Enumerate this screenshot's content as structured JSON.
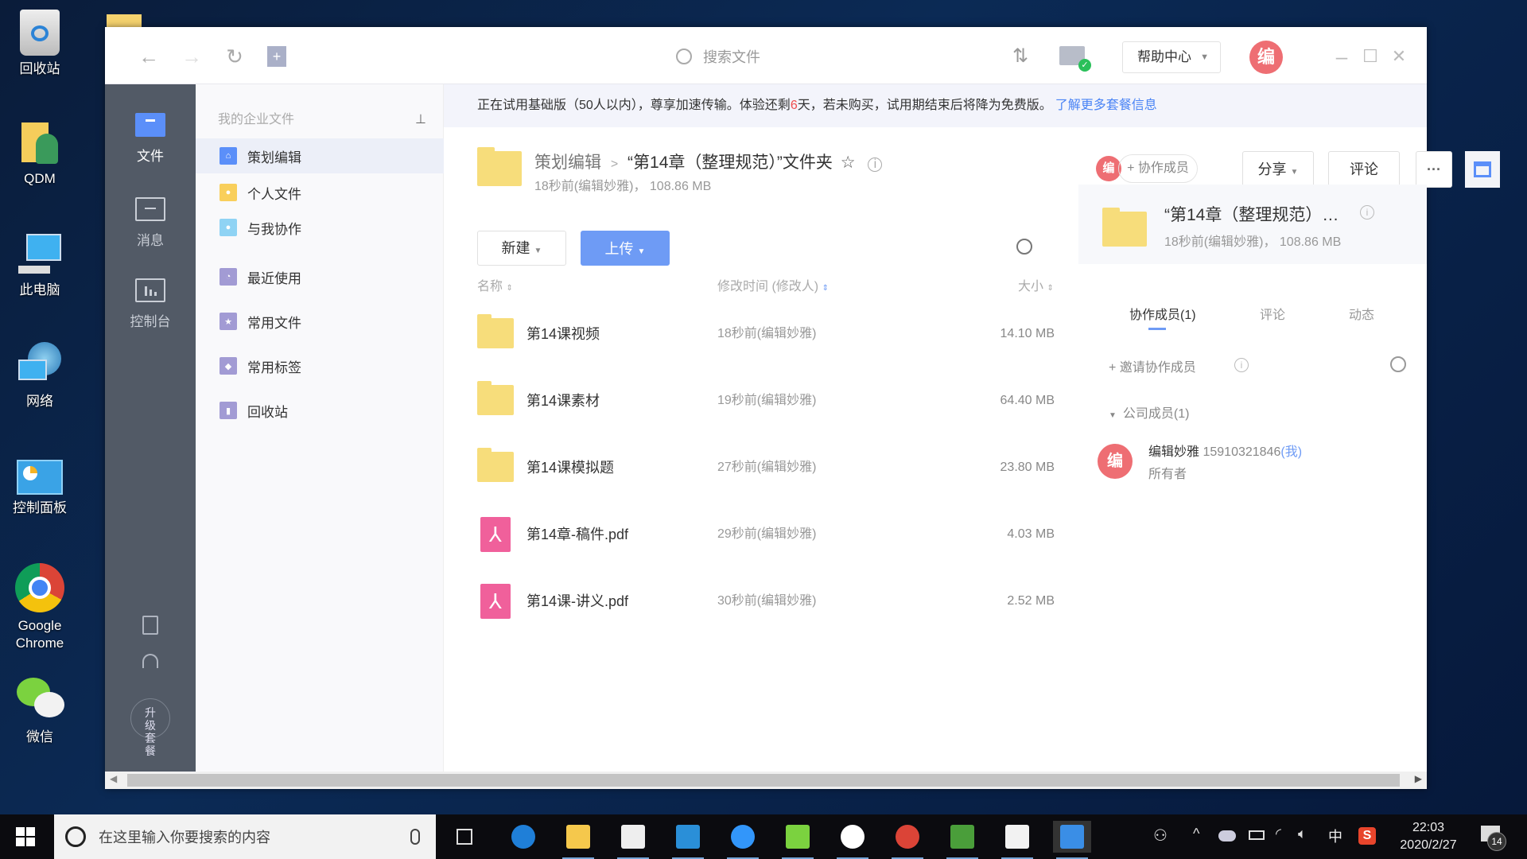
{
  "desktop": {
    "icons": [
      {
        "label": "回收站",
        "icon": "recycle-bin-icon"
      },
      {
        "label": "QDM",
        "icon": "user-folder-icon"
      },
      {
        "label": "此电脑",
        "icon": "computer-icon"
      },
      {
        "label": "网络",
        "icon": "network-icon"
      },
      {
        "label": "控制面板",
        "icon": "control-panel-icon"
      },
      {
        "label": "Google Chrome",
        "icon": "chrome-icon"
      },
      {
        "label": "微信",
        "icon": "wechat-icon"
      }
    ]
  },
  "app": {
    "search_placeholder": "搜索文件",
    "help_center": "帮助中心",
    "user_avatar": "编",
    "nav": [
      {
        "label": "文件",
        "icon": "folder-icon",
        "active": true
      },
      {
        "label": "消息",
        "icon": "message-icon",
        "active": false
      },
      {
        "label": "控制台",
        "icon": "dashboard-icon",
        "active": false
      }
    ],
    "upgrade_label": "升级套餐",
    "folder_panel": {
      "header": "我的企业文件",
      "items": [
        {
          "label": "策划编辑",
          "icon": "org-icon",
          "color": "#5b8ff9",
          "active": true
        },
        {
          "label": "个人文件",
          "icon": "person-icon",
          "color": "#f9cf5b",
          "active": false
        },
        {
          "label": "与我协作",
          "icon": "collab-icon",
          "color": "#8fd3f4",
          "active": false
        },
        {
          "label": "最近使用",
          "icon": "clock-icon",
          "color": "#a29bd4",
          "active": false
        },
        {
          "label": "常用文件",
          "icon": "star-icon",
          "color": "#a29bd4",
          "active": false
        },
        {
          "label": "常用标签",
          "icon": "tag-icon",
          "color": "#a29bd4",
          "active": false
        },
        {
          "label": "回收站",
          "icon": "trash-icon",
          "color": "#a29bd4",
          "active": false
        }
      ]
    },
    "banner": {
      "text_before": "正在试用基础版（50人以内），尊享加速传输。体验还剩",
      "days": "6",
      "text_after": "天，若未购买，试用期结束后将降为免费版。",
      "link": "了解更多套餐信息"
    },
    "breadcrumb": {
      "parent": "策划编辑",
      "separator": ">",
      "current": "“第14章（整理规范）”文件夹",
      "meta": "18秒前(编辑妙雅)， 108.86 MB"
    },
    "header_actions": {
      "collab_avatar": "编",
      "add_collab": "+ 协作成员",
      "share": "分享",
      "comment": "评论",
      "more": "···"
    },
    "toolbar": {
      "new_label": "新建",
      "upload_label": "上传"
    },
    "table": {
      "columns": [
        "名称",
        "修改时间 (修改人)",
        "大小"
      ],
      "rows": [
        {
          "type": "folder",
          "name": "第14课视频",
          "time": "18秒前(编辑妙雅)",
          "size": "14.10 MB"
        },
        {
          "type": "folder",
          "name": "第14课素材",
          "time": "19秒前(编辑妙雅)",
          "size": "64.40 MB"
        },
        {
          "type": "folder",
          "name": "第14课模拟题",
          "time": "27秒前(编辑妙雅)",
          "size": "23.80 MB"
        },
        {
          "type": "pdf",
          "name": "第14章-稿件.pdf",
          "time": "29秒前(编辑妙雅)",
          "size": "4.03 MB"
        },
        {
          "type": "pdf",
          "name": "第14课-讲义.pdf",
          "time": "30秒前(编辑妙雅)",
          "size": "2.52 MB"
        }
      ]
    },
    "detail": {
      "title": "“第14章（整理规范）…",
      "meta": "18秒前(编辑妙雅)， 108.86 MB",
      "tabs": [
        {
          "label": "协作成员(1)",
          "active": true
        },
        {
          "label": "评论",
          "active": false
        },
        {
          "label": "动态",
          "active": false
        }
      ],
      "invite": "+ 邀请协作成员",
      "group": "公司成员(1)",
      "member": {
        "avatar": "编",
        "name": "编辑妙雅",
        "phone": "15910321846",
        "me": "(我)",
        "role": "所有者"
      }
    }
  },
  "taskbar": {
    "search_placeholder": "在这里输入你要搜索的内容",
    "apps": [
      "edge-icon",
      "file-explorer-icon",
      "store-icon",
      "mail-icon",
      "dingtalk-icon",
      "wechat-icon",
      "feishu-icon",
      "chrome-icon",
      "camtasia-icon",
      "camtasia-recorder-icon",
      "cloud-drive-icon"
    ],
    "tray": {
      "ime": "中",
      "time": "22:03",
      "date": "2020/2/27",
      "notifications": "14"
    }
  }
}
